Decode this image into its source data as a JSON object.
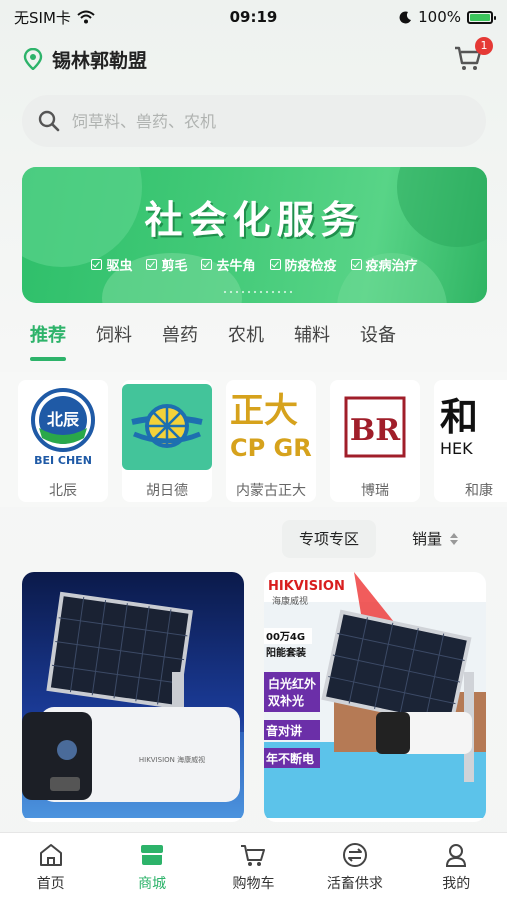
{
  "status_bar": {
    "carrier": "无SIM卡",
    "time": "09:19",
    "battery": "100%"
  },
  "header": {
    "location": "锡林郭勒盟",
    "cart_badge": "1"
  },
  "search": {
    "placeholder": "饲草料、兽药、农机"
  },
  "banner": {
    "title": "社会化服务",
    "tags": [
      "驱虫",
      "剪毛",
      "去牛角",
      "防疫检疫",
      "疫病治疗"
    ]
  },
  "tabs": [
    "推荐",
    "饲料",
    "兽药",
    "农机",
    "辅料",
    "设备"
  ],
  "brands": [
    {
      "name": "北辰",
      "logo_text": "北辰",
      "logo_sub": "BEI CHEN"
    },
    {
      "name": "胡日德"
    },
    {
      "name": "内蒙古正大",
      "logo_text": "正大",
      "logo_sub": "CP GR"
    },
    {
      "name": "博瑞",
      "logo_text": "BR"
    },
    {
      "name": "和康",
      "logo_text": "和",
      "logo_sub": "HEK"
    }
  ],
  "filter": {
    "special_label": "专项专区",
    "sort_label": "销量"
  },
  "products": [
    {
      "brand_mark": "HIKVISION 海康威视"
    },
    {
      "brand_mark": "HIKVISION",
      "brand_cn": "海康威视",
      "lines": [
        "00万4G",
        "阳能套装",
        "白光红外",
        "双补光",
        "音对讲",
        "年不断电"
      ]
    }
  ],
  "bottom_nav": [
    {
      "label": "首页",
      "icon": "home-icon"
    },
    {
      "label": "商城",
      "icon": "store-icon"
    },
    {
      "label": "购物车",
      "icon": "cart-icon"
    },
    {
      "label": "活畜供求",
      "icon": "exchange-icon"
    },
    {
      "label": "我的",
      "icon": "user-icon"
    }
  ],
  "colors": {
    "accent": "#2db36a",
    "badge": "#e53935",
    "banner": "#41c977"
  }
}
